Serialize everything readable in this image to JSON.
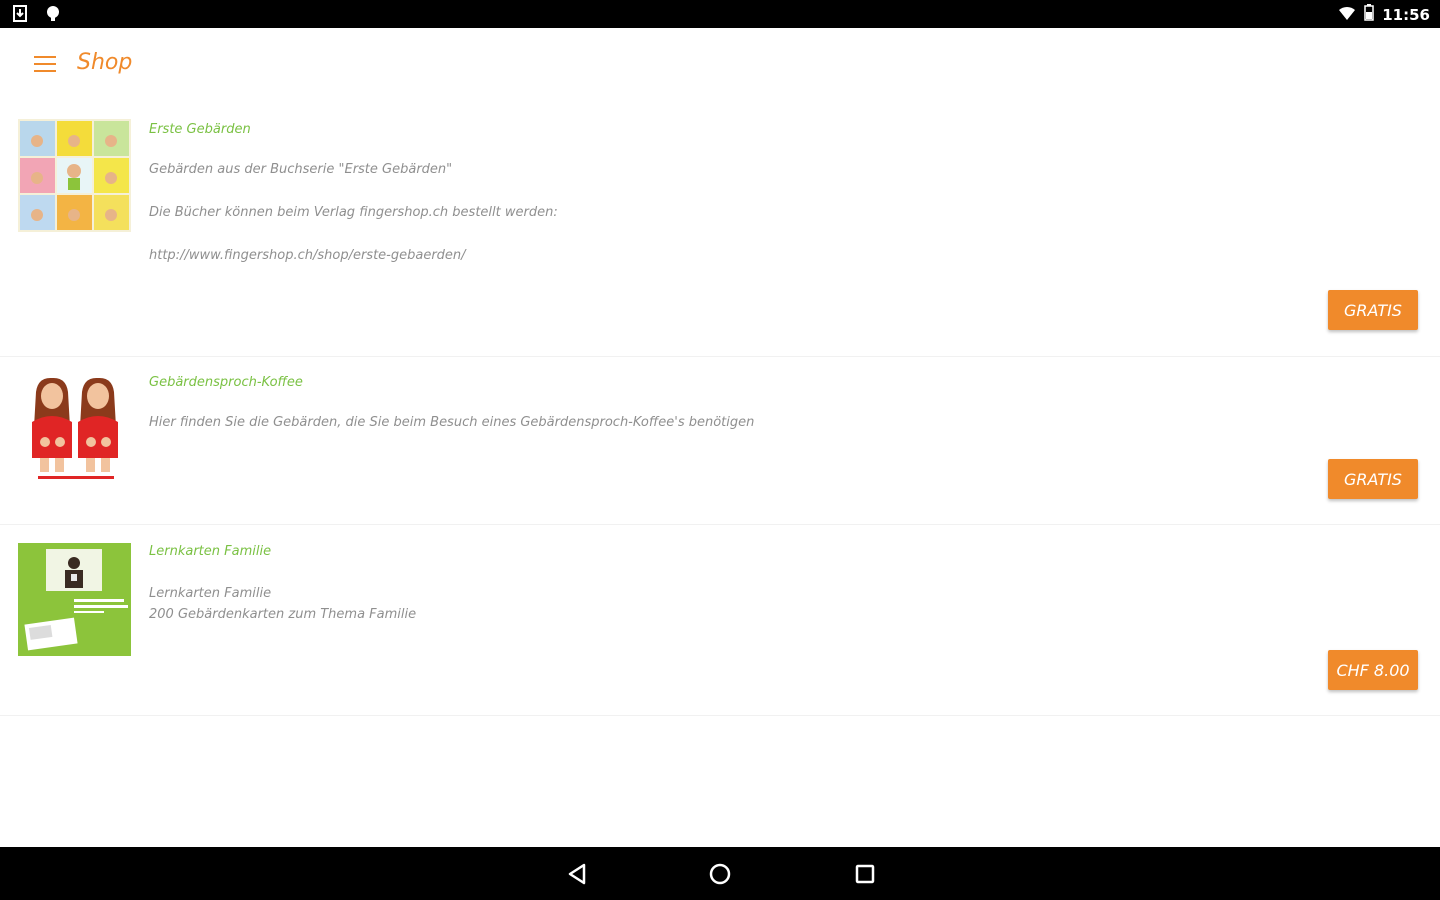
{
  "status_bar": {
    "time": "11:56",
    "icons": [
      "download-icon",
      "notification-icon",
      "wifi-icon",
      "battery-icon"
    ]
  },
  "toolbar": {
    "title": "Shop",
    "menu_icon": "hamburger-icon"
  },
  "products": [
    {
      "title": "Erste Gebärden",
      "description_lines": [
        "Gebärden aus der Buchserie \"Erste Gebärden\"",
        "Die Bücher können beim Verlag fingershop.ch bestellt werden:",
        "http://www.fingershop.ch/shop/erste-gebaerden/"
      ],
      "price": "GRATIS",
      "image": "book-covers-collage"
    },
    {
      "title": "Gebärdensproch-Koffee",
      "description_lines": [
        "Hier finden Sie die Gebärden, die Sie beim Besuch eines Gebärdensproch-Koffee's benötigen"
      ],
      "price": "GRATIS",
      "image": "two-signing-women"
    },
    {
      "title": "Lernkarten Familie",
      "description_lines": [
        "Lernkarten Familie",
        "200 Gebärdenkarten zum Thema Familie"
      ],
      "price": "CHF 8.00",
      "image": "green-learning-card"
    }
  ],
  "nav_bar": {
    "icons": [
      "back-icon",
      "home-icon",
      "recents-icon"
    ]
  },
  "colors": {
    "accent": "#f08a2b",
    "title_green": "#7ac143",
    "text_grey": "#8f8f8f"
  }
}
